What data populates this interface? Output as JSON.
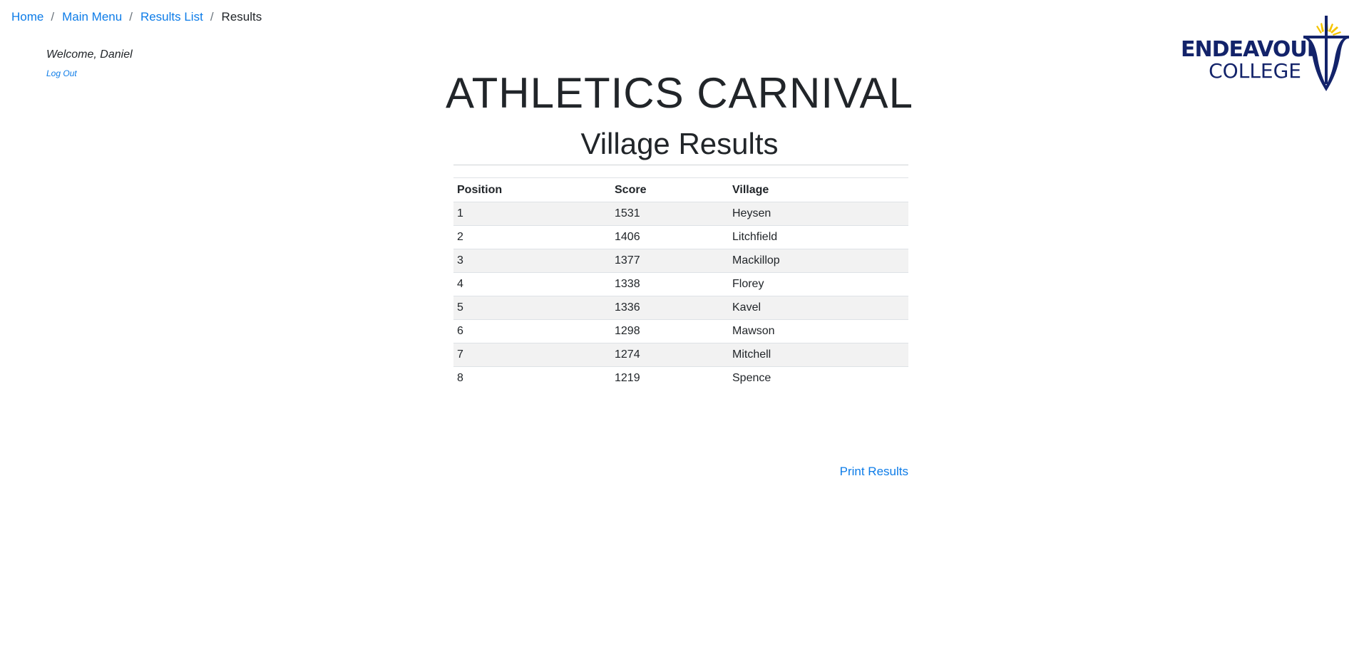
{
  "breadcrumb": {
    "items": [
      {
        "label": "Home"
      },
      {
        "label": "Main Menu"
      },
      {
        "label": "Results List"
      }
    ],
    "current": "Results",
    "separator": "/"
  },
  "user": {
    "welcome": "Welcome, Daniel",
    "logout_label": "Log Out"
  },
  "logo": {
    "line1": "ENDEAVOUR",
    "line2": "COLLEGE"
  },
  "header": {
    "title": "ATHLETICS CARNIVAL",
    "subtitle": "Village Results"
  },
  "table": {
    "columns": [
      "Position",
      "Score",
      "Village"
    ],
    "rows": [
      [
        "1",
        "1531",
        "Heysen"
      ],
      [
        "2",
        "1406",
        "Litchfield"
      ],
      [
        "3",
        "1377",
        "Mackillop"
      ],
      [
        "4",
        "1338",
        "Florey"
      ],
      [
        "5",
        "1336",
        "Kavel"
      ],
      [
        "6",
        "1298",
        "Mawson"
      ],
      [
        "7",
        "1274",
        "Mitchell"
      ],
      [
        "8",
        "1219",
        "Spence"
      ]
    ]
  },
  "actions": {
    "print_label": "Print Results"
  },
  "colors": {
    "link": "#0d7ce8",
    "brand_navy": "#13236a",
    "brand_yellow": "#f5c400",
    "stripe": "#f2f2f2"
  }
}
